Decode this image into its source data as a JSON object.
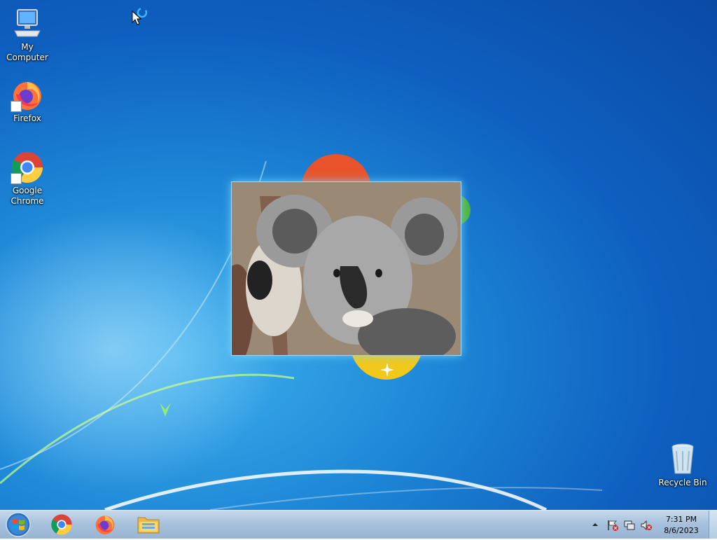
{
  "desktop": {
    "icons": [
      {
        "label": "My Computer",
        "icon": "computer-icon"
      },
      {
        "label": "Firefox",
        "icon": "firefox-icon"
      },
      {
        "label": "Google Chrome",
        "icon": "chrome-icon"
      },
      {
        "label": "Recycle Bin",
        "icon": "recycle-bin-icon"
      }
    ],
    "preview_image": "koala-photo"
  },
  "taskbar": {
    "pinned": [
      {
        "name": "Google Chrome",
        "icon": "chrome-icon"
      },
      {
        "name": "Firefox",
        "icon": "firefox-icon"
      },
      {
        "name": "Windows Explorer",
        "icon": "folder-icon"
      }
    ],
    "tray_icons": [
      "show-hidden-icons-arrow",
      "action-center-flag-icon",
      "network-icon",
      "volume-muted-icon"
    ],
    "clock": {
      "time": "7:31 PM",
      "date": "8/6/2023"
    }
  },
  "colors": {
    "accent": "#1d86d6",
    "taskbar": "#a8c2dd"
  }
}
